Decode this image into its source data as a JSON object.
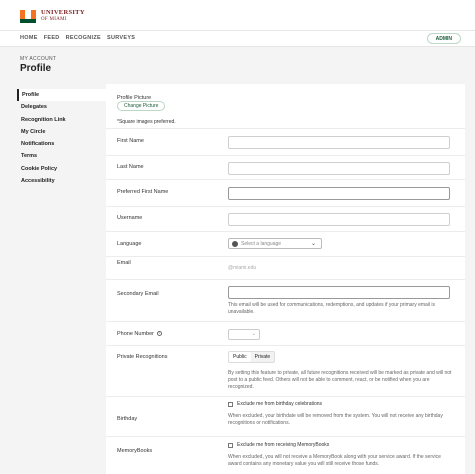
{
  "brand": {
    "line1": "UNIVERSITY",
    "line2": "OF MIAMI",
    "colors": {
      "orange": "#f47321",
      "green": "#005030"
    }
  },
  "nav": {
    "items": [
      "HOME",
      "FEED",
      "RECOGNIZE",
      "SURVEYS"
    ],
    "admin_label": "ADMIN"
  },
  "header": {
    "section": "MY ACCOUNT",
    "title": "Profile"
  },
  "sidebar": {
    "items": [
      "Profile",
      "Delegates",
      "Recognition Link",
      "My Circle",
      "Notifications",
      "Terms",
      "Cookie Policy",
      "Accessibility"
    ]
  },
  "form": {
    "picture": {
      "label": "Profile Picture",
      "button": "Change Picture",
      "note": "*Square images preferred."
    },
    "first_name": {
      "label": "First Name",
      "value": ""
    },
    "last_name": {
      "label": "Last Name",
      "value": ""
    },
    "preferred_first_name": {
      "label": "Preferred First Name",
      "value": ""
    },
    "username": {
      "label": "Username",
      "value": ""
    },
    "language": {
      "label": "Language",
      "placeholder": "Select a language"
    },
    "email": {
      "label": "Email",
      "value": "@miami.edu"
    },
    "secondary_email": {
      "label": "Secondary Email",
      "value": "",
      "help": "This email will be used for communications, redemptions, and updates if your primary email is unavailable."
    },
    "phone": {
      "label": "Phone Number"
    },
    "private_recognitions": {
      "label": "Private Recognitions",
      "options": [
        "Public",
        "Private"
      ],
      "selected": "Public",
      "help": "By setting this feature to private, all future recognitions received will be marked as private and will not post to a public feed. Others will not be able to comment, react, or be notified when you are recognized."
    },
    "birthday": {
      "label": "Birthday",
      "checkbox": "Exclude me from birthday celebrations",
      "help": "When excluded, your birthdate will be removed from the system. You will not receive any birthday recognitions or notifications."
    },
    "memorybooks": {
      "label": "MemoryBooks",
      "checkbox": "Exclude me from receiving MemoryBooks",
      "help": "When excluded, you will not receive a MemoryBook along with your service award. If the service award contains any monetary value you will still receive those funds."
    }
  }
}
